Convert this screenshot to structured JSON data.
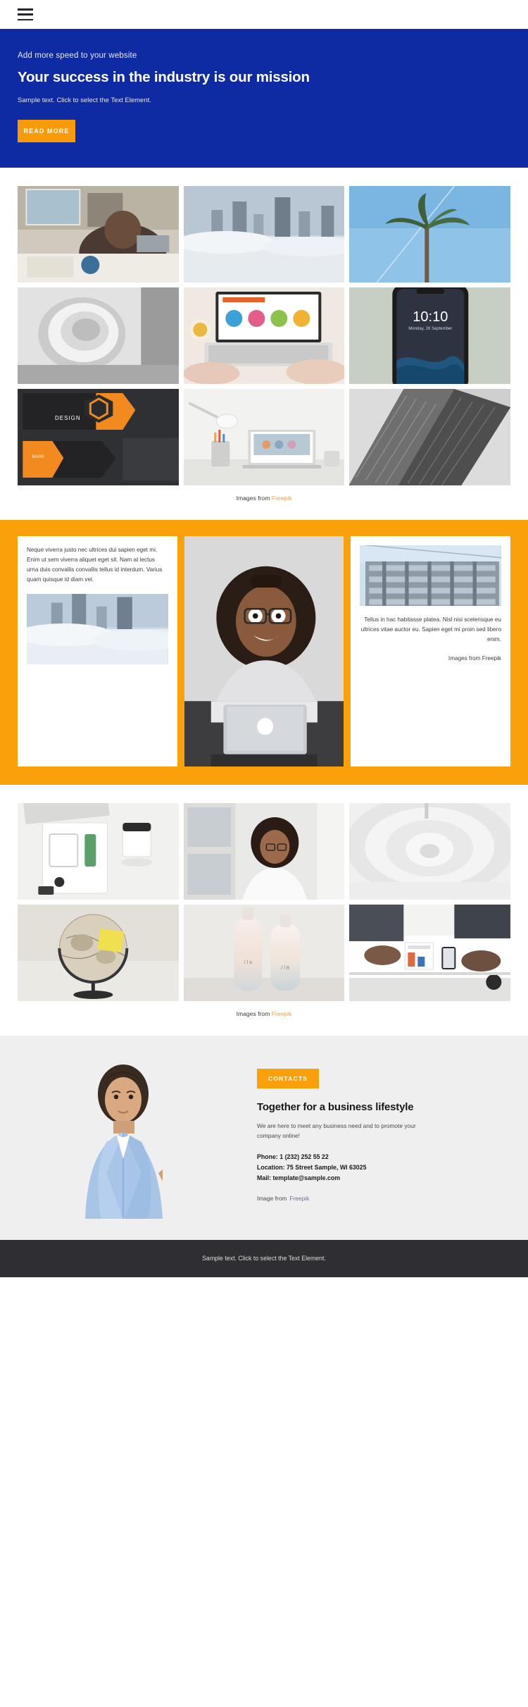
{
  "nav": {
    "menu_label": "menu"
  },
  "hero": {
    "eyebrow": "Add more speed to your website",
    "title": "Your success in the industry is our mission",
    "subtitle": "Sample text. Click to select the Text Element.",
    "button": "READ MORE",
    "bg_color": "#0f2ba3",
    "button_color": "#f99b09"
  },
  "gallery_one": {
    "credit_prefix": "Images from ",
    "credit_link": "Freepik",
    "items": [
      {
        "alt": "man writing in notebook at desk with coffee"
      },
      {
        "alt": "city skyscrapers above clouds"
      },
      {
        "alt": "palm tree against blue sky"
      },
      {
        "alt": "white spiral architectural staircase"
      },
      {
        "alt": "hands typing on laptop with marketing charts"
      },
      {
        "alt": "smartphone showing 10:10 lockscreen"
      },
      {
        "alt": "black and orange business card design mockup"
      },
      {
        "alt": "desk with laptop, lamp and pencils"
      },
      {
        "alt": "black and white skyscraper looking up"
      }
    ]
  },
  "feature": {
    "bg_color": "#f9a00b",
    "left_text": "Neque viverra justo nec ultrices dui sapien eget mi. Enim ut sem viverra aliquet eget sit. Nam at lectus urna duis convallis convallis tellus id interdum. Varius quam quisque id diam vel.",
    "left_image_alt": "city towers above cloud layer",
    "center_image_alt": "smiling woman with curly hair using a laptop",
    "right_image_alt": "modern glass office building facade",
    "right_text": "Tellus in hac habitasse platea. Nisl nisi scelerisque eu ultrices vitae auctor eu. Sapien eget mi proin sed libero enim.",
    "right_credit": "Images from Freepik"
  },
  "gallery_two": {
    "credit_prefix": "Images from ",
    "credit_link": "Freepik",
    "items": [
      {
        "alt": "flat lay notebook, pen and mug on desk"
      },
      {
        "alt": "woman with curly hair looking down by window"
      },
      {
        "alt": "white curved modern corridor"
      },
      {
        "alt": "vintage globe with yellow sticky note"
      },
      {
        "alt": "two gradient cosmetic bottles"
      },
      {
        "alt": "team meeting with phones and charts on table"
      }
    ]
  },
  "contact": {
    "photo_alt": "businesswoman in light blue blazer pointing",
    "badge": "CONTACTS",
    "heading": "Together for a business lifestyle",
    "lead": "We are here to meet any business need and to promote your company online!",
    "phone": "Phone: 1 (232) 252 55 22",
    "location": "Location: 75 Street Sample, WI 63025",
    "mail": "Mail: template@sample.com",
    "credit_prefix": "Image from",
    "credit_link": "Freepik",
    "bg_color": "#efefef"
  },
  "footer": {
    "text": "Sample text. Click to select the Text Element.",
    "bg_color": "#2f2f33"
  }
}
